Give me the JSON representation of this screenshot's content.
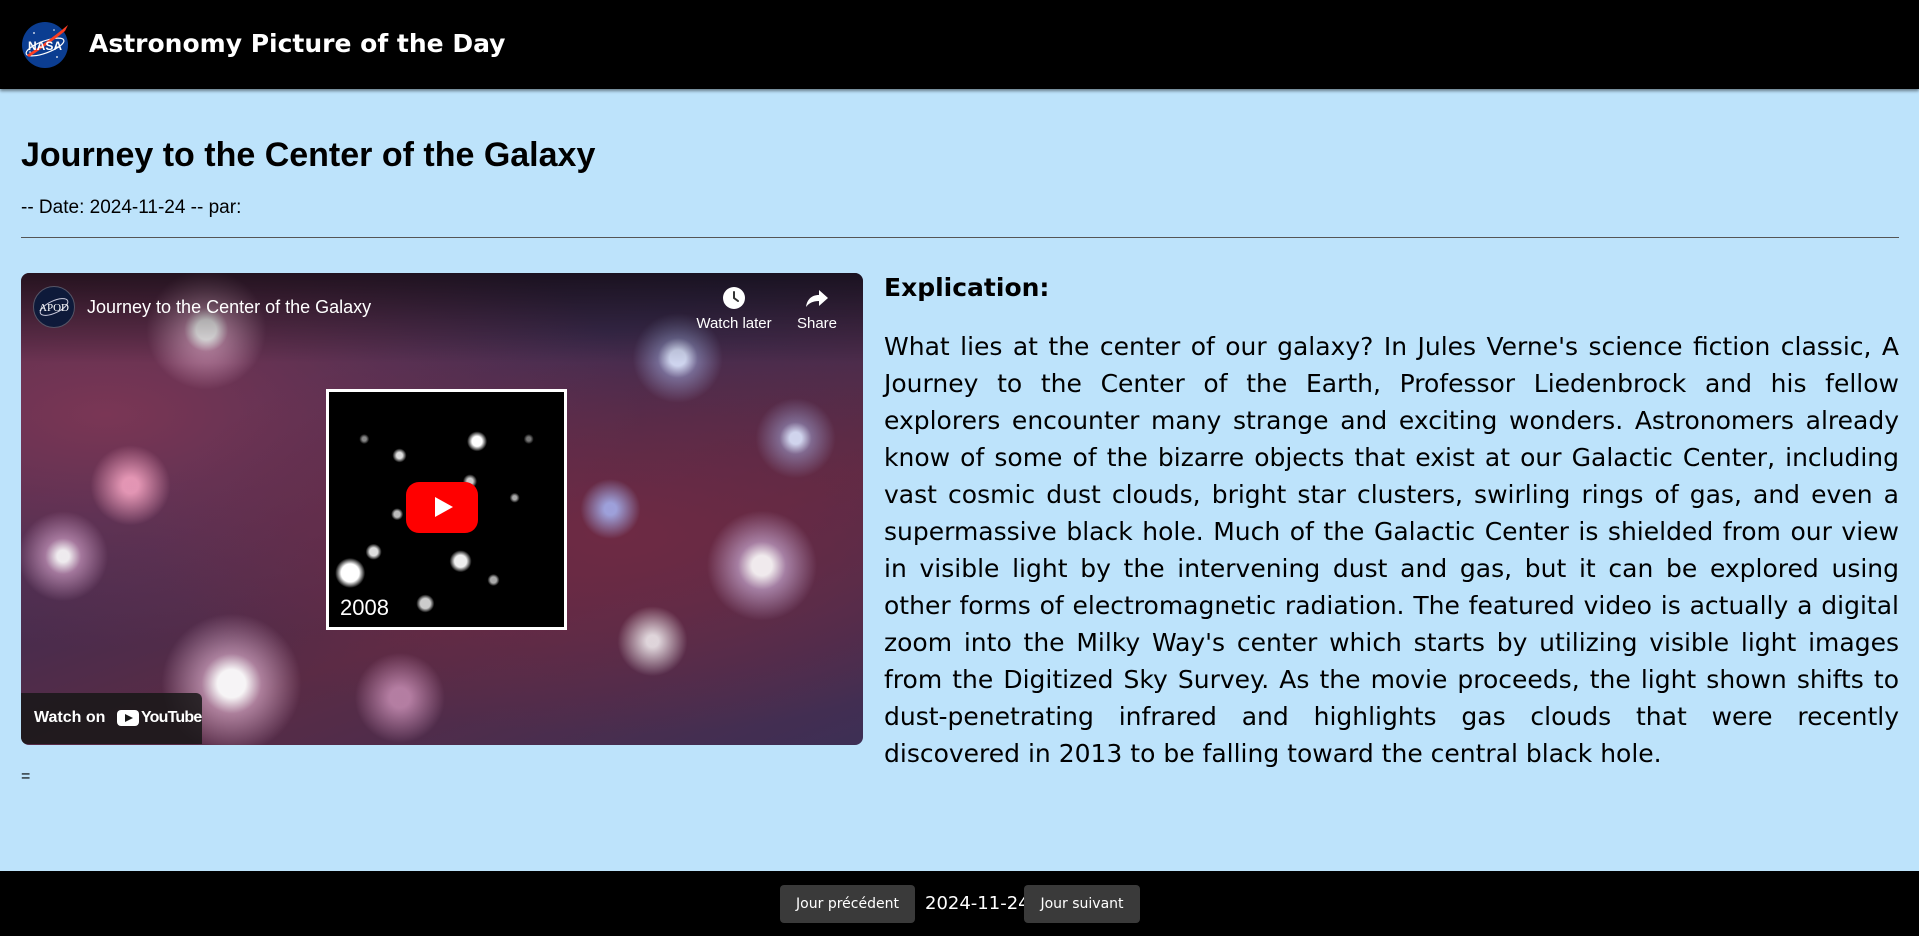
{
  "header": {
    "logo_text": "NASA",
    "site_title": "Astronomy Picture of the Day"
  },
  "article": {
    "title": "Journey to the Center of the Galaxy",
    "meta_line": "-- Date: 2024-11-24 -- par:",
    "trailing_mark": "="
  },
  "video": {
    "channel_initials": "APOD",
    "title": "Journey to the Center of the Galaxy",
    "watch_later_label": "Watch later",
    "share_label": "Share",
    "thumbnail_year": "2008",
    "watch_on_label": "Watch on",
    "youtube_label": "YouTube"
  },
  "explanation": {
    "heading": "Explication:",
    "text": "What lies at the center of our galaxy? In Jules Verne's science fiction classic, A Journey to the Center of the Earth, Professor Liedenbrock and his fellow explorers encounter many strange and exciting wonders. Astronomers already know of some of the bizarre objects that exist at our Galactic Center, including vast cosmic dust clouds, bright star clusters, swirling rings of gas, and even a supermassive black hole. Much of the Galactic Center is shielded from our view in visible light by the intervening dust and gas, but it can be explored using other forms of electromagnetic radiation. The featured video is actually a digital zoom into the Milky Way's center which starts by utilizing visible light images from the Digitized Sky Survey. As the movie proceeds, the light shown shifts to dust-penetrating infrared and highlights gas clouds that were recently discovered in 2013 to be falling toward the central black hole."
  },
  "footer": {
    "prev_label": "Jour précédent",
    "date": "2024-11-24",
    "next_label": "Jour suivant"
  },
  "colors": {
    "page_background": "#bde3fb",
    "bars": "#000000",
    "nav_button": "#3a3a3a",
    "play_button": "#ff0000",
    "nasa_blue": "#0b3d91",
    "nasa_red": "#fc3d21"
  },
  "icons": [
    "nasa-logo-icon",
    "clock-icon",
    "share-arrow-icon",
    "play-icon",
    "youtube-logo-icon"
  ]
}
